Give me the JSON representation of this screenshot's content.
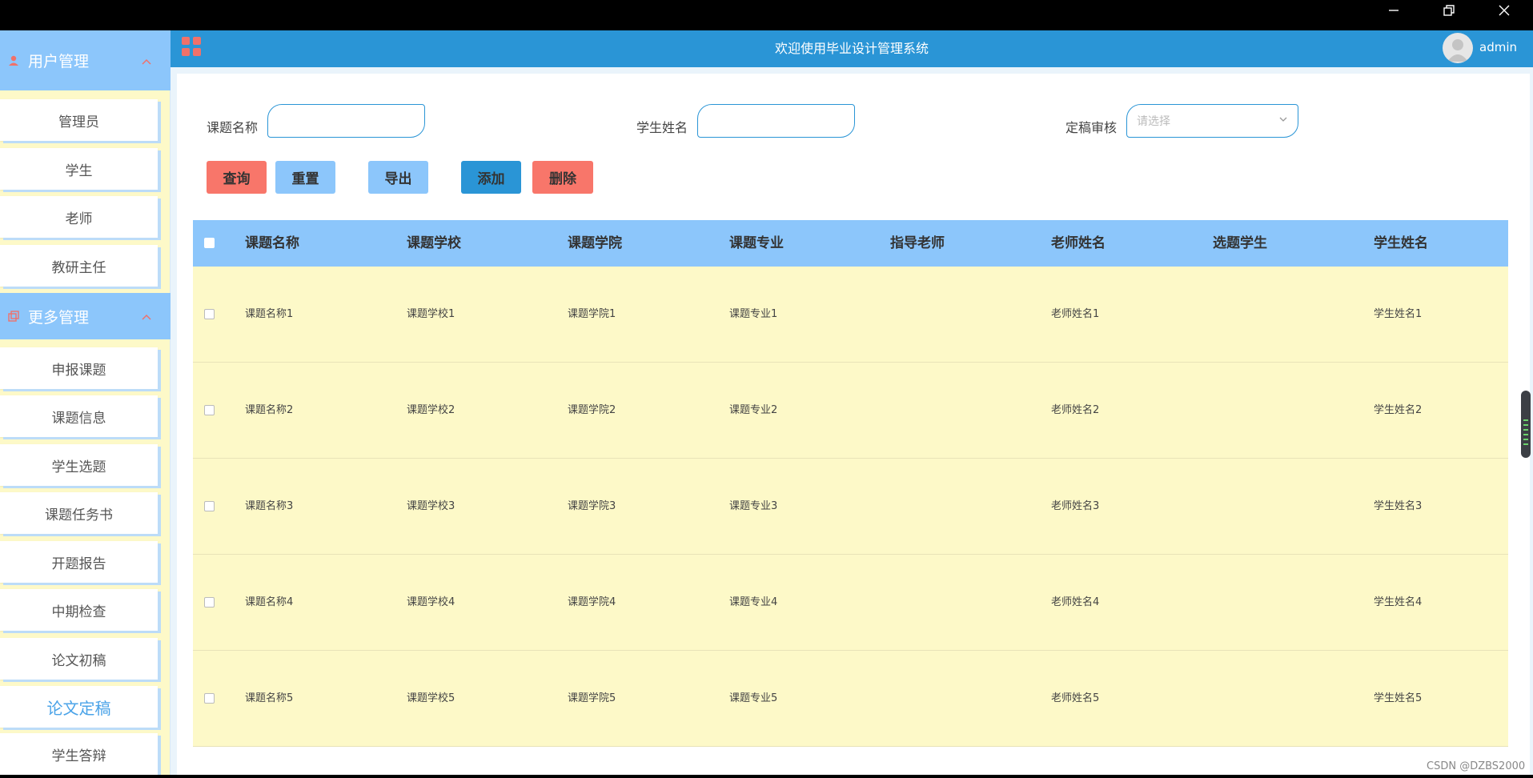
{
  "sidebar": {
    "groups": [
      {
        "label": "用户管理",
        "icon": "user-icon"
      },
      {
        "label": "更多管理",
        "icon": "copy-icon"
      }
    ],
    "items": [
      "管理员",
      "学生",
      "老师",
      "教研主任",
      "申报课题",
      "课题信息",
      "学生选题",
      "课题任务书",
      "开题报告",
      "中期检查",
      "论文初稿",
      "论文定稿",
      "学生答辩"
    ]
  },
  "header": {
    "title": "欢迎使用毕业设计管理系统",
    "username": "admin"
  },
  "search": {
    "topic_label": "课题名称",
    "student_label": "学生姓名",
    "review_label": "定稿审核",
    "review_placeholder": "请选择"
  },
  "buttons": {
    "query": "查询",
    "reset": "重置",
    "export": "导出",
    "add": "添加",
    "delete": "删除"
  },
  "table": {
    "columns": [
      "课题名称",
      "课题学校",
      "课题学院",
      "课题专业",
      "指导老师",
      "老师姓名",
      "选题学生",
      "学生姓名"
    ],
    "rows": [
      [
        "课题名称1",
        "课题学校1",
        "课题学院1",
        "课题专业1",
        "",
        "老师姓名1",
        "",
        "学生姓名1"
      ],
      [
        "课题名称2",
        "课题学校2",
        "课题学院2",
        "课题专业2",
        "",
        "老师姓名2",
        "",
        "学生姓名2"
      ],
      [
        "课题名称3",
        "课题学校3",
        "课题学院3",
        "课题专业3",
        "",
        "老师姓名3",
        "",
        "学生姓名3"
      ],
      [
        "课题名称4",
        "课题学校4",
        "课题学院4",
        "课题专业4",
        "",
        "老师姓名4",
        "",
        "学生姓名4"
      ],
      [
        "课题名称5",
        "课题学校5",
        "课题学院5",
        "课题专业5",
        "",
        "老师姓名5",
        "",
        "学生姓名5"
      ]
    ]
  },
  "watermark": "CSDN @DZBS2000",
  "colors": {
    "primary": "#2a95d6",
    "light_blue": "#8cc6fb",
    "row_bg": "#fdf9c8",
    "danger": "#f8766a"
  }
}
